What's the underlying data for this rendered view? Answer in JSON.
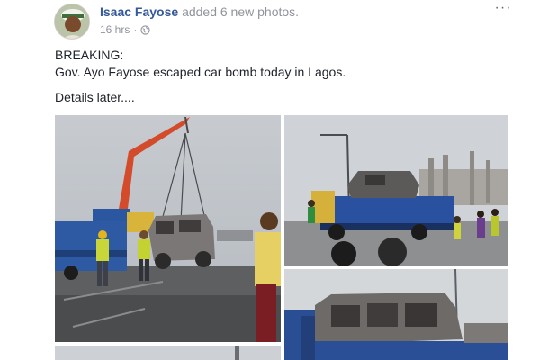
{
  "post": {
    "author_name": "Isaac Fayose",
    "action_text": "added 6 new photos.",
    "timestamp": "16 hrs",
    "separator": "·",
    "privacy_icon": "globe-icon",
    "more_icon": "more-options-icon",
    "more_label": "···",
    "text_lines": [
      "BREAKING:",
      "Gov. Ayo Fayose escaped car bomb today in Lagos.",
      "Details later...."
    ],
    "photos": [
      {
        "name": "photo-crane-burnt-suv"
      },
      {
        "name": "photo-truck-on-road"
      },
      {
        "name": "photo-burnt-vehicle-closeup"
      },
      {
        "name": "photo-fourth-partial"
      }
    ]
  },
  "colors": {
    "link": "#365899",
    "muted": "#90949c",
    "text": "#1d2129"
  }
}
